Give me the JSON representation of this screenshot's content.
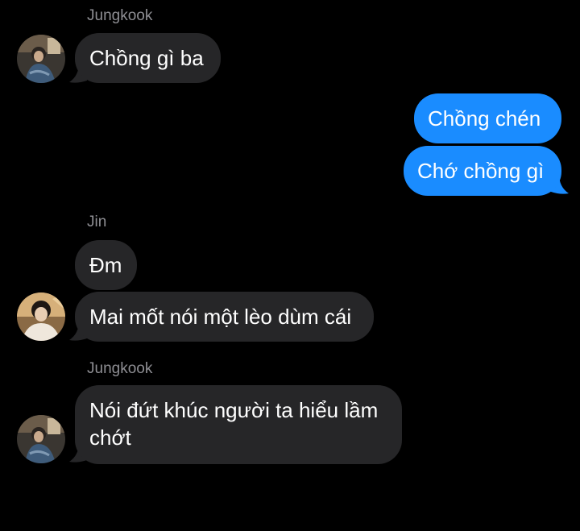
{
  "colors": {
    "background": "#000000",
    "incoming_bubble": "#262628",
    "outgoing_bubble": "#1a8cff",
    "sender_name": "#8e8e93",
    "text": "#ffffff"
  },
  "messages": {
    "group1": {
      "sender": "Jungkook",
      "avatar_icon": "jungkook-avatar",
      "bubbles": [
        "Chồng gì ba"
      ]
    },
    "group2": {
      "sender": "me",
      "bubbles": [
        "Chồng chén",
        "Chớ chồng gì"
      ]
    },
    "group3": {
      "sender": "Jin",
      "avatar_icon": "jin-avatar",
      "bubbles": [
        "Đm",
        "Mai mốt nói một lèo dùm cái"
      ]
    },
    "group4": {
      "sender": "Jungkook",
      "avatar_icon": "jungkook-avatar",
      "bubbles": [
        "Nói đứt khúc người ta hiểu lầm chớt"
      ]
    }
  }
}
